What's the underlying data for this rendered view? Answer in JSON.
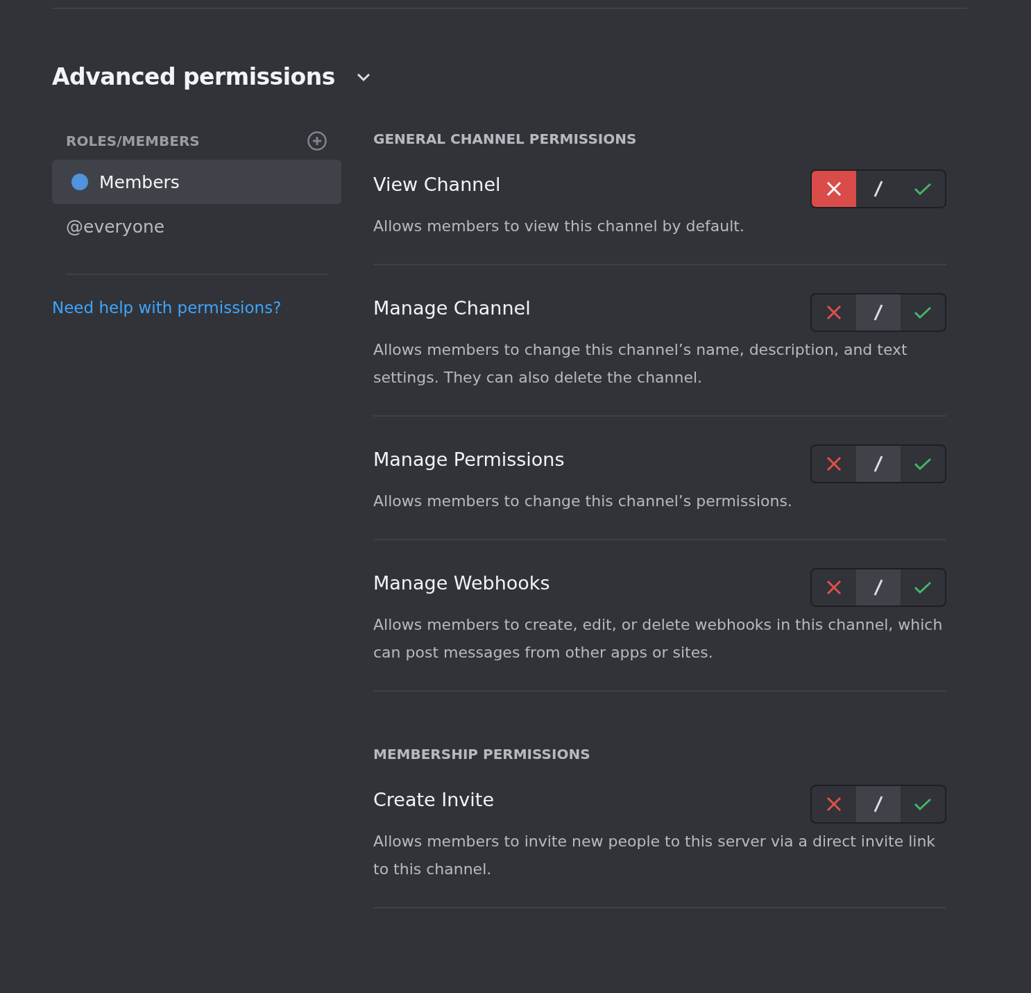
{
  "header": {
    "title": "Advanced permissions",
    "expanded": true
  },
  "roles": {
    "heading": "ROLES/MEMBERS",
    "items": [
      {
        "label": "Members",
        "selected": true,
        "color": "#4f94dc"
      },
      {
        "label": "@everyone",
        "selected": false
      }
    ],
    "help_link": "Need help with permissions?"
  },
  "sections": [
    {
      "heading": "GENERAL CHANNEL PERMISSIONS",
      "permissions": [
        {
          "name": "View Channel",
          "description": "Allows members to view this channel by default.",
          "options": [
            {
              "kind": "deny",
              "selected": true
            },
            {
              "kind": "inherit",
              "selected": false
            },
            {
              "kind": "allow",
              "selected": false
            }
          ]
        },
        {
          "name": "Manage Channel",
          "description": "Allows members to change this channel’s name, description, and text settings. They can also delete the channel.",
          "options": [
            {
              "kind": "deny",
              "selected": false
            },
            {
              "kind": "inherit",
              "selected": true
            },
            {
              "kind": "allow",
              "selected": false
            }
          ]
        },
        {
          "name": "Manage Permissions",
          "description": "Allows members to change this channel’s permissions.",
          "options": [
            {
              "kind": "deny",
              "selected": false
            },
            {
              "kind": "inherit",
              "selected": true
            },
            {
              "kind": "allow",
              "selected": false
            }
          ]
        },
        {
          "name": "Manage Webhooks",
          "description": "Allows members to create, edit, or delete webhooks in this channel, which can post messages from other apps or sites.",
          "options": [
            {
              "kind": "deny",
              "selected": false
            },
            {
              "kind": "inherit",
              "selected": true
            },
            {
              "kind": "allow",
              "selected": false
            }
          ]
        }
      ]
    },
    {
      "heading": "MEMBERSHIP PERMISSIONS",
      "permissions": [
        {
          "name": "Create Invite",
          "description": "Allows members to invite new people to this server via a direct invite link to this channel.",
          "options": [
            {
              "kind": "deny",
              "selected": false
            },
            {
              "kind": "inherit",
              "selected": true
            },
            {
              "kind": "allow",
              "selected": false
            }
          ]
        }
      ]
    }
  ]
}
